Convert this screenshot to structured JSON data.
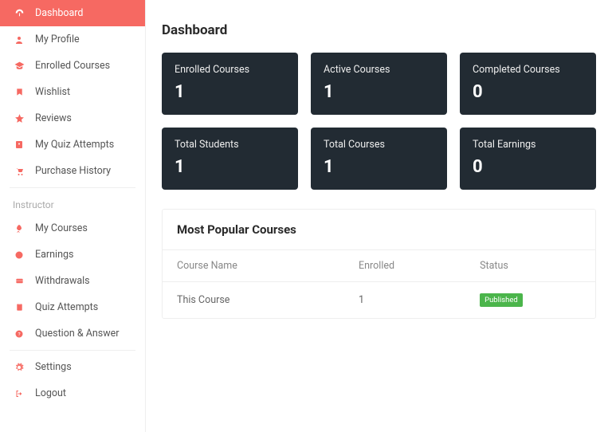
{
  "page_title": "Dashboard",
  "sidebar": {
    "main_items": [
      {
        "label": "Dashboard",
        "icon": "dashboard-icon",
        "active": true
      },
      {
        "label": "My Profile",
        "icon": "user-icon",
        "active": false
      },
      {
        "label": "Enrolled Courses",
        "icon": "graduation-icon",
        "active": false
      },
      {
        "label": "Wishlist",
        "icon": "bookmark-icon",
        "active": false
      },
      {
        "label": "Reviews",
        "icon": "star-icon",
        "active": false
      },
      {
        "label": "My Quiz Attempts",
        "icon": "quiz-icon",
        "active": false
      },
      {
        "label": "Purchase History",
        "icon": "cart-icon",
        "active": false
      }
    ],
    "instructor_label": "Instructor",
    "instructor_items": [
      {
        "label": "My Courses",
        "icon": "rocket-icon"
      },
      {
        "label": "Earnings",
        "icon": "coin-icon"
      },
      {
        "label": "Withdrawals",
        "icon": "wallet-icon"
      },
      {
        "label": "Quiz Attempts",
        "icon": "clipboard-icon"
      },
      {
        "label": "Question & Answer",
        "icon": "question-icon"
      }
    ],
    "footer_items": [
      {
        "label": "Settings",
        "icon": "gear-icon"
      },
      {
        "label": "Logout",
        "icon": "logout-icon"
      }
    ]
  },
  "stats": [
    {
      "label": "Enrolled Courses",
      "value": "1"
    },
    {
      "label": "Active Courses",
      "value": "1"
    },
    {
      "label": "Completed Courses",
      "value": "0"
    },
    {
      "label": "Total Students",
      "value": "1"
    },
    {
      "label": "Total Courses",
      "value": "1"
    },
    {
      "label": "Total Earnings",
      "value": "0"
    }
  ],
  "popular": {
    "title": "Most Popular Courses",
    "columns": [
      "Course Name",
      "Enrolled",
      "Status"
    ],
    "rows": [
      {
        "name": "This Course",
        "enrolled": "1",
        "status": "Published"
      }
    ]
  }
}
